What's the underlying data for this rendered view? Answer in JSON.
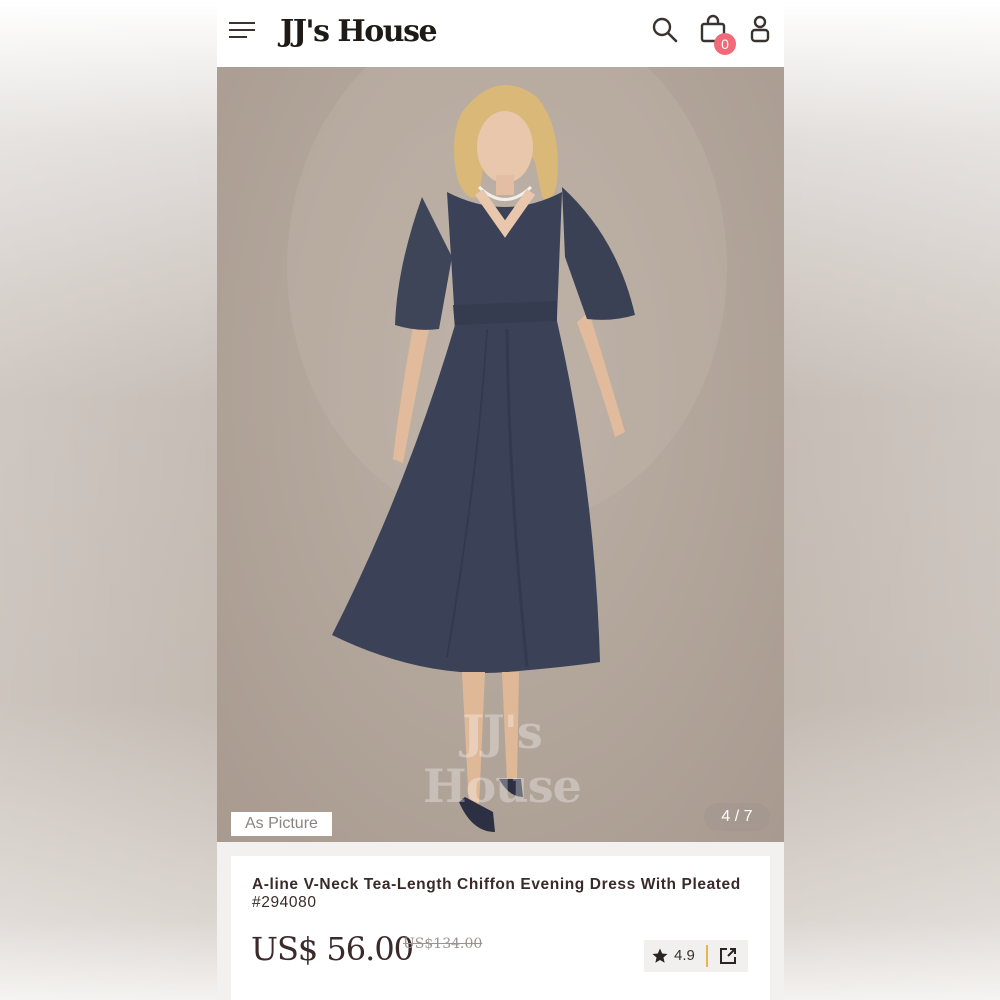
{
  "header": {
    "logo": "JJ's House",
    "cart_count": "0"
  },
  "gallery": {
    "watermark": "JJ's House",
    "color_label": "As Picture",
    "counter": "4 / 7",
    "current_index": 4,
    "total": 7
  },
  "product": {
    "title": "A-line V-Neck Tea-Length Chiffon Evening Dress With Pleated",
    "sku": "#294080",
    "price": "US$ 56.00",
    "original_price": "US$134.00",
    "rating": "4.9"
  },
  "icons": {
    "menu": "hamburger-menu-icon",
    "search": "search-icon",
    "cart": "shopping-bag-icon",
    "user": "user-icon",
    "star": "star-icon",
    "share": "share-icon"
  },
  "colors": {
    "badge": "#f06b78",
    "dress": "#3b4257",
    "rating_divider": "#e8b64a",
    "text_dark": "#3a2a2a"
  }
}
